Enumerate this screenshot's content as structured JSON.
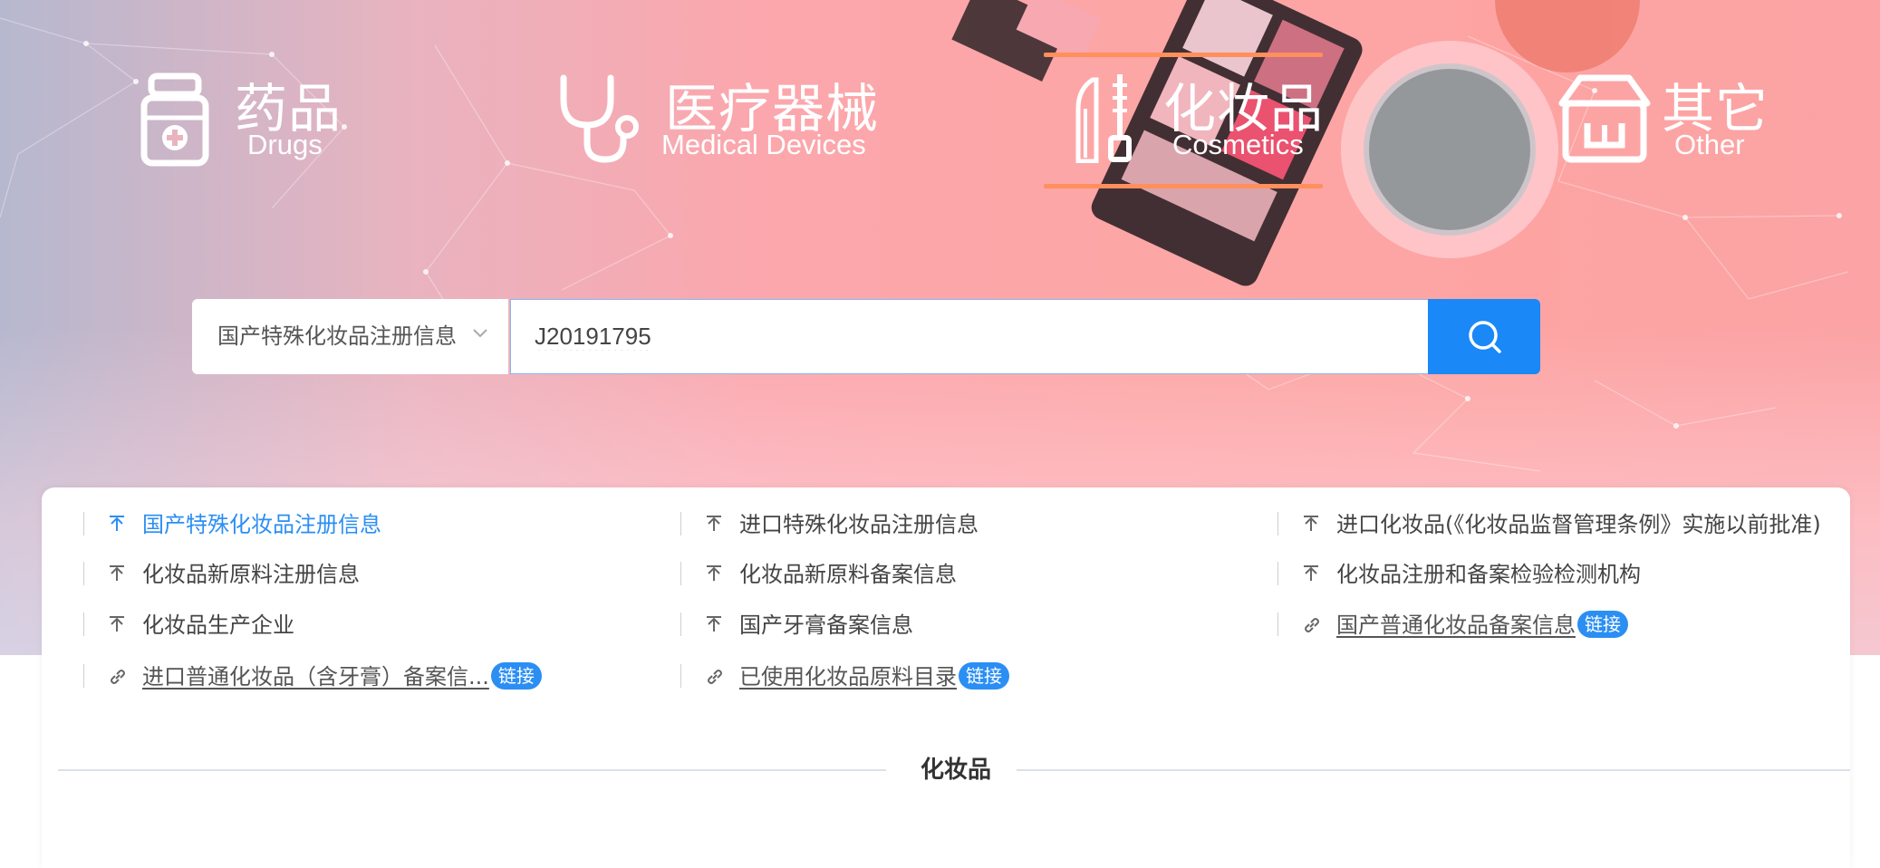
{
  "categories": [
    {
      "zh": "药品",
      "en": "Drugs",
      "icon": "medicine-box-icon"
    },
    {
      "zh": "医疗器械",
      "en": "Medical Devices",
      "icon": "stethoscope-icon"
    },
    {
      "zh": "化妆品",
      "en": "Cosmetics",
      "icon": "lipstick-icon",
      "active": true
    },
    {
      "zh": "其它",
      "en": "Other",
      "icon": "shop-icon"
    }
  ],
  "search": {
    "scope": "国产特殊化妆品注册信息",
    "value": "J20191795",
    "button_icon": "search-icon"
  },
  "links": [
    {
      "label": "国产特殊化妆品注册信息",
      "icon": "upload-icon",
      "active": true
    },
    {
      "label": "进口特殊化妆品注册信息",
      "icon": "upload-icon"
    },
    {
      "label": "进口化妆品(《化妆品监督管理条例》实施以前批准)",
      "icon": "upload-icon"
    },
    {
      "label": "化妆品新原料注册信息",
      "icon": "upload-icon"
    },
    {
      "label": "化妆品新原料备案信息",
      "icon": "upload-icon"
    },
    {
      "label": "化妆品注册和备案检验检测机构",
      "icon": "upload-icon"
    },
    {
      "label": "化妆品生产企业",
      "icon": "upload-icon"
    },
    {
      "label": "国产牙膏备案信息",
      "icon": "upload-icon"
    },
    {
      "label": "国产普通化妆品备案信息",
      "icon": "link-icon",
      "badge": "链接"
    },
    {
      "label": "进口普通化妆品（含牙膏）备案信...",
      "icon": "link-icon",
      "badge": "链接"
    },
    {
      "label": "已使用化妆品原料目录",
      "icon": "link-icon",
      "badge": "链接"
    }
  ],
  "section_title": "化妆品",
  "colors": {
    "accent": "#1a88f7",
    "active_link": "#2b8ef3",
    "tab_underline": "#ff8f5c"
  }
}
